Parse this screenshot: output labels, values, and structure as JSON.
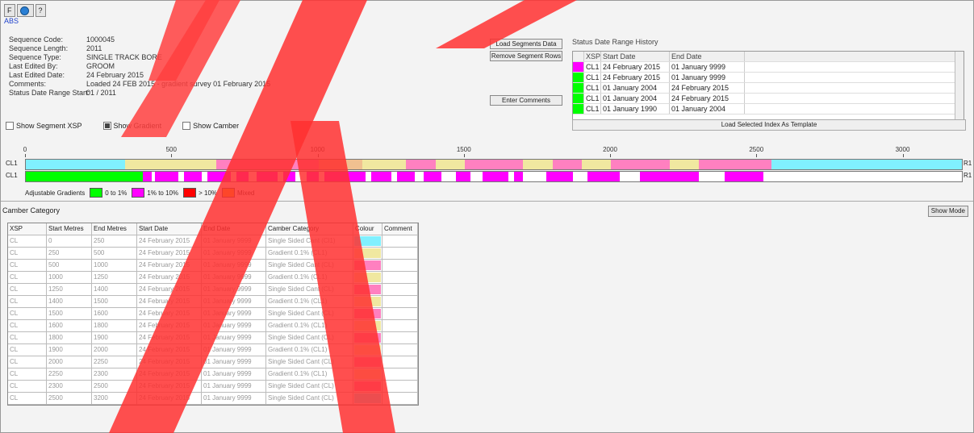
{
  "tabs": [
    {
      "label": "F"
    },
    {
      "label": "?"
    }
  ],
  "project_link": "ABS",
  "properties": [
    {
      "label": "Sequence Code:",
      "value": "1000045"
    },
    {
      "label": "Sequence Length:",
      "value": "2011"
    },
    {
      "label": "Sequence Type:",
      "value": "SINGLE TRACK BORE"
    },
    {
      "label": "Last Edited By:",
      "value": "GROOM"
    },
    {
      "label": "Last Edited Date:",
      "value": "24 February 2015"
    },
    {
      "label": "Comments:",
      "value": "Loaded 24 FEB 2015 - gradient survey 01 February 2015"
    },
    {
      "label": "Status Date Range Start:",
      "value": "01 / 2011"
    }
  ],
  "options": {
    "show_sidemark": "Show Segment XSP",
    "show_gradient": "Show Gradient",
    "show_cant": "Show Camber",
    "checked": [
      false,
      true,
      false
    ]
  },
  "buttons": {
    "load_new": "Load Segments Data",
    "remove": "Remove Segment Rows",
    "enter_comments": "Enter Comments",
    "load_template": "Load Selected Index As Template",
    "mode": "Show Mode"
  },
  "history": {
    "title": "Status Date Range History",
    "headers": [
      "XSP",
      "Start Date",
      "End Date"
    ],
    "rows": [
      {
        "color": "#ff00ff",
        "xsp": "CL1",
        "start": "24 February 2015",
        "end": "01 January 9999"
      },
      {
        "color": "#00ff00",
        "xsp": "CL1",
        "start": "24 February 2015",
        "end": "01 January 9999"
      },
      {
        "color": "#00ff00",
        "xsp": "CL1",
        "start": "01 January 2004",
        "end": "24 February 2015"
      },
      {
        "color": "#00ff00",
        "xsp": "CL1",
        "start": "01 January 2004",
        "end": "24 February 2015"
      },
      {
        "color": "#00ff00",
        "xsp": "CL1",
        "start": "01 January 1990",
        "end": "01 January 2004"
      }
    ]
  },
  "axis": {
    "ticks": [
      "0",
      "500",
      "1000",
      "1500",
      "2000",
      "2500",
      "3000"
    ],
    "max": 3200
  },
  "tracks": [
    {
      "label": "CL1",
      "end_label": "R1",
      "segments": [
        {
          "start": 0,
          "end": 340,
          "color": "#80f0ff"
        },
        {
          "start": 340,
          "end": 650,
          "color": "#f0e8a0"
        },
        {
          "start": 650,
          "end": 1000,
          "color": "#ff80c0"
        },
        {
          "start": 1000,
          "end": 1150,
          "color": "#f0c090"
        },
        {
          "start": 1150,
          "end": 1300,
          "color": "#f0e8a0"
        },
        {
          "start": 1300,
          "end": 1400,
          "color": "#ff80c0"
        },
        {
          "start": 1400,
          "end": 1500,
          "color": "#f0e8a0"
        },
        {
          "start": 1500,
          "end": 1700,
          "color": "#ff80c0"
        },
        {
          "start": 1700,
          "end": 1800,
          "color": "#f0e8a0"
        },
        {
          "start": 1800,
          "end": 1900,
          "color": "#ff80c0"
        },
        {
          "start": 1900,
          "end": 2000,
          "color": "#f0e8a0"
        },
        {
          "start": 2000,
          "end": 2200,
          "color": "#ff80c0"
        },
        {
          "start": 2200,
          "end": 2300,
          "color": "#f0e8a0"
        },
        {
          "start": 2300,
          "end": 2550,
          "color": "#ff80c0"
        },
        {
          "start": 2550,
          "end": 3200,
          "color": "#80f0ff"
        }
      ]
    },
    {
      "label": "CL1",
      "end_label": "R1",
      "segments": [
        {
          "start": 0,
          "end": 400,
          "color": "#00ff00"
        },
        {
          "start": 400,
          "end": 430,
          "color": "#ff00ff"
        },
        {
          "start": 440,
          "end": 520,
          "color": "#ff00ff"
        },
        {
          "start": 540,
          "end": 600,
          "color": "#ff00ff"
        },
        {
          "start": 620,
          "end": 700,
          "color": "#ff00ff"
        },
        {
          "start": 720,
          "end": 760,
          "color": "#ff00ff"
        },
        {
          "start": 790,
          "end": 860,
          "color": "#ff00ff"
        },
        {
          "start": 880,
          "end": 920,
          "color": "#ff00ff"
        },
        {
          "start": 960,
          "end": 1000,
          "color": "#ff00ff"
        },
        {
          "start": 1020,
          "end": 1160,
          "color": "#ff00ff"
        },
        {
          "start": 1180,
          "end": 1250,
          "color": "#ff00ff"
        },
        {
          "start": 1270,
          "end": 1330,
          "color": "#ff00ff"
        },
        {
          "start": 1360,
          "end": 1420,
          "color": "#ff00ff"
        },
        {
          "start": 1470,
          "end": 1520,
          "color": "#ff00ff"
        },
        {
          "start": 1560,
          "end": 1650,
          "color": "#ff00ff"
        },
        {
          "start": 1670,
          "end": 1700,
          "color": "#ff00ff"
        },
        {
          "start": 1780,
          "end": 1870,
          "color": "#ff00ff"
        },
        {
          "start": 1920,
          "end": 2030,
          "color": "#ff00ff"
        },
        {
          "start": 2100,
          "end": 2300,
          "color": "#ff00ff"
        },
        {
          "start": 2390,
          "end": 2520,
          "color": "#ff00ff"
        }
      ]
    }
  ],
  "legend": [
    {
      "label": "Adjustable Gradients",
      "color": ""
    },
    {
      "label": "0 to 1%",
      "color": "#00ff00"
    },
    {
      "label": "1% to 10%",
      "color": "#ff00ff"
    },
    {
      "label": "> 10%",
      "color": "#ff0000"
    },
    {
      "label": "Mixed",
      "color": "#f0c000"
    }
  ],
  "group_label": "Camber Category",
  "table": {
    "headers": [
      "XSP",
      "Start Metres",
      "End Metres",
      "Start Date",
      "End Date",
      "Camber Category",
      "Colour",
      "Comment"
    ],
    "rows": [
      [
        "CL",
        "0",
        "250",
        "24 February 2015",
        "01 January 9999",
        "Single Sided Cant (Cl1)",
        "#80f0ff",
        ""
      ],
      [
        "CL",
        "250",
        "500",
        "24 February 2015",
        "01 January 9999",
        "Gradient 0.1% (CL1)",
        "#f0e8a0",
        ""
      ],
      [
        "CL",
        "500",
        "1000",
        "24 February 2015",
        "01 January 9999",
        "Single Sided Cant (CL)",
        "#ff80c0",
        ""
      ],
      [
        "CL",
        "1000",
        "1250",
        "24 February 2015",
        "01 January 9999",
        "Gradient 0.1% (CL1)",
        "#f0e8a0",
        ""
      ],
      [
        "CL",
        "1250",
        "1400",
        "24 February 2015",
        "01 January 9999",
        "Single Sided Cant (CL)",
        "#ff80c0",
        ""
      ],
      [
        "CL",
        "1400",
        "1500",
        "24 February 2015",
        "01 January 9999",
        "Gradient 0.1% (CL1)",
        "#f0e8a0",
        ""
      ],
      [
        "CL",
        "1500",
        "1600",
        "24 February 2015",
        "01 January 9999",
        "Single Sided Cant (CL)",
        "#ff80c0",
        ""
      ],
      [
        "CL",
        "1600",
        "1800",
        "24 February 2015",
        "01 January 9999",
        "Gradient 0.1% (CL1)",
        "#f0e8a0",
        ""
      ],
      [
        "CL",
        "1800",
        "1900",
        "24 February 2015",
        "01 January 9999",
        "Single Sided Cant (CL)",
        "#ff80c0",
        ""
      ],
      [
        "CL",
        "1900",
        "2000",
        "24 February 2015",
        "01 January 9999",
        "Gradient 0.1% (CL1)",
        "#f0e8a0",
        ""
      ],
      [
        "CL",
        "2000",
        "2250",
        "24 February 2015",
        "01 January 9999",
        "Single Sided Cant (CL)",
        "#ff80c0",
        ""
      ],
      [
        "CL",
        "2250",
        "2300",
        "24 February 2015",
        "01 January 9999",
        "Gradient 0.1% (CL1)",
        "#f0e8a0",
        ""
      ],
      [
        "CL",
        "2300",
        "2500",
        "24 February 2015",
        "01 January 9999",
        "Single Sided Cant (CL)",
        "#ff80c0",
        ""
      ],
      [
        "CL",
        "2500",
        "3200",
        "24 February 2015",
        "01 January 9999",
        "Single Sided Cant (CL)",
        "#80f0ff",
        ""
      ]
    ]
  }
}
